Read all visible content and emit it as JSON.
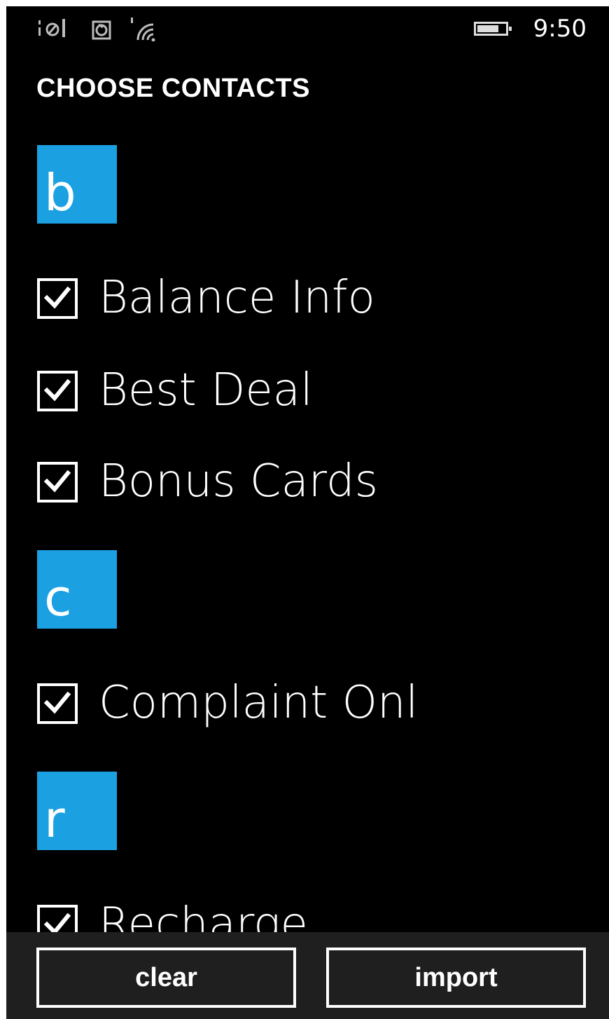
{
  "status_bar": {
    "time": "9:50",
    "icons": [
      "signal-icon",
      "sync-icon",
      "wifi-icon",
      "battery-icon"
    ]
  },
  "page": {
    "title": "CHOOSE CONTACTS"
  },
  "colors": {
    "accent": "#1ba1e2",
    "background": "#000000",
    "app_bar": "#1f1f1f"
  },
  "groups": [
    {
      "letter": "b",
      "contacts": [
        {
          "name": "Balance Info",
          "checked": true
        },
        {
          "name": "Best Deal",
          "checked": true
        },
        {
          "name": "Bonus Cards",
          "checked": true
        }
      ]
    },
    {
      "letter": "c",
      "contacts": [
        {
          "name": "Complaint Onl",
          "checked": true
        }
      ]
    },
    {
      "letter": "r",
      "contacts": [
        {
          "name": "Recharge",
          "checked": true
        }
      ]
    }
  ],
  "app_bar": {
    "clear_label": "clear",
    "import_label": "import"
  }
}
